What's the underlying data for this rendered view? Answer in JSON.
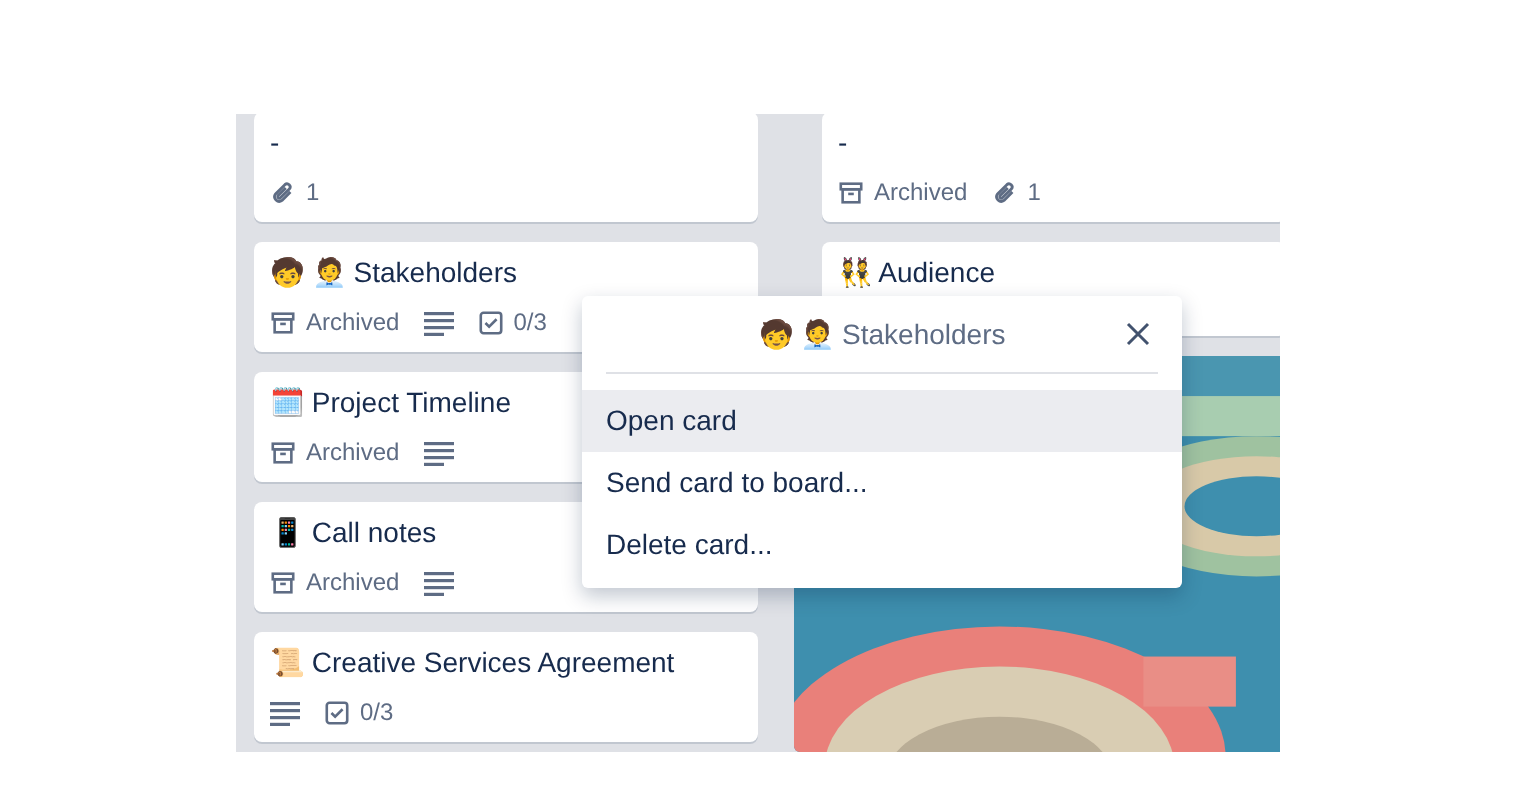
{
  "columns": [
    {
      "cards": [
        {
          "title": "-",
          "badges": [
            {
              "kind": "attachment",
              "text": "1"
            }
          ]
        },
        {
          "title": "🧒 🧑‍💼 Stakeholders",
          "badges": [
            {
              "kind": "archived",
              "text": "Archived"
            },
            {
              "kind": "description"
            },
            {
              "kind": "checklist",
              "text": "0/3"
            }
          ]
        },
        {
          "title": "🗓️ Project Timeline",
          "badges": [
            {
              "kind": "archived",
              "text": "Archived"
            },
            {
              "kind": "description"
            }
          ]
        },
        {
          "title": "📱 Call notes",
          "badges": [
            {
              "kind": "archived",
              "text": "Archived"
            },
            {
              "kind": "description"
            }
          ]
        },
        {
          "title": "📜 Creative Services Agreement",
          "badges": [
            {
              "kind": "description"
            },
            {
              "kind": "checklist",
              "text": "0/3"
            }
          ]
        }
      ]
    },
    {
      "cards": [
        {
          "title": "-",
          "badges": [
            {
              "kind": "archived",
              "text": "Archived"
            },
            {
              "kind": "attachment",
              "text": "1"
            }
          ]
        },
        {
          "title": "👯 Audience"
        },
        {
          "kind": "picture"
        }
      ]
    }
  ],
  "menu": {
    "title": "🧒 🧑‍💼 Stakeholders",
    "items": [
      {
        "label": "Open card",
        "selected": true
      },
      {
        "label": "Send card to board...",
        "selected": false
      },
      {
        "label": "Delete card...",
        "selected": false
      }
    ]
  }
}
